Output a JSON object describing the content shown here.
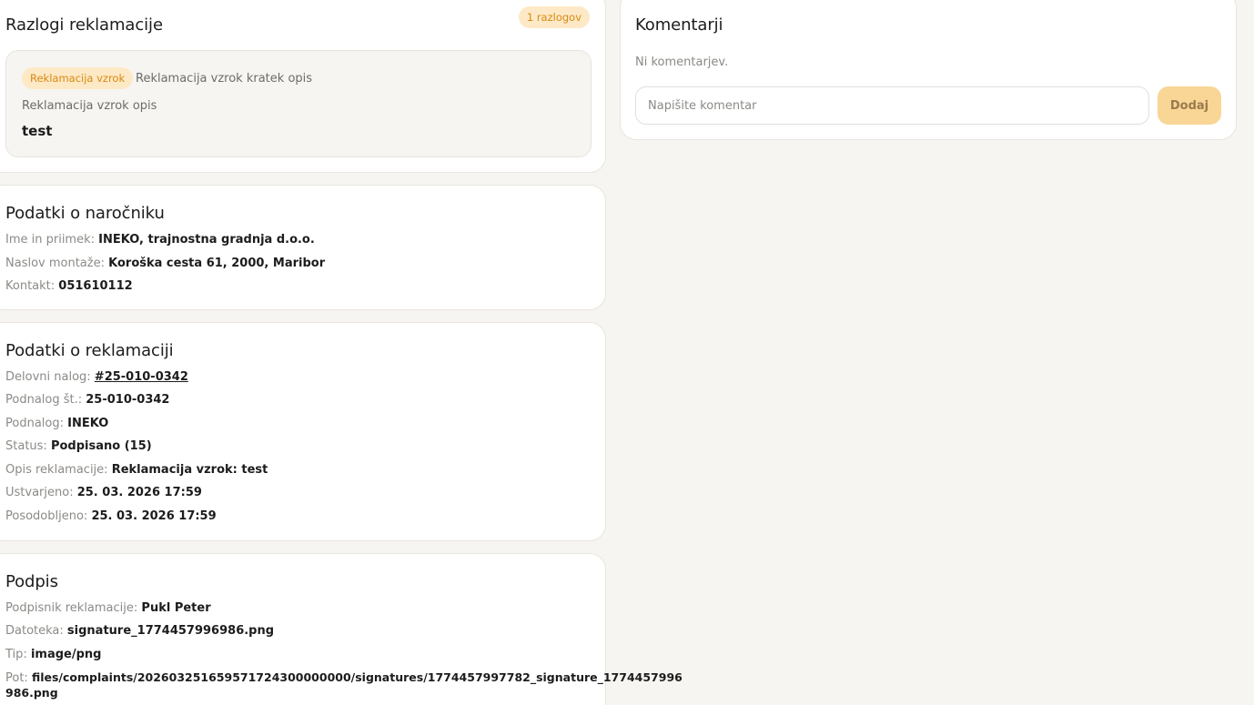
{
  "reasons": {
    "title": "Razlogi reklamacije",
    "count_badge": "1 razlogov",
    "items": [
      {
        "tag": "Reklamacija vzrok",
        "short_description": "Reklamacija vzrok kratek opis",
        "description_label": "Reklamacija vzrok opis",
        "description": "test"
      }
    ]
  },
  "customer": {
    "title": "Podatki o naročniku",
    "name_label": "Ime in priimek:",
    "name": "INEKO, trajnostna gradnja d.o.o.",
    "address_label": "Naslov montaže:",
    "address": "Koroška cesta 61, 2000, Maribor",
    "contact_label": "Kontakt:",
    "contact": "051610112"
  },
  "complaint": {
    "title": "Podatki o reklamaciji",
    "work_order_label": "Delovni nalog:",
    "work_order": "#25-010-0342",
    "suborder_no_label": "Podnalog št.:",
    "suborder_no": "25-010-0342",
    "suborder_label": "Podnalog:",
    "suborder": "INEKO",
    "status_label": "Status:",
    "status": "Podpisano (15)",
    "description_label": "Opis reklamacije:",
    "description": "Reklamacija vzrok: test",
    "created_label": "Ustvarjeno:",
    "created": "25. 03. 2026 17:59",
    "updated_label": "Posodobljeno:",
    "updated": "25. 03. 2026 17:59"
  },
  "signature": {
    "title": "Podpis",
    "signer_label": "Podpisnik reklamacije:",
    "signer": "Pukl Peter",
    "file_label": "Datoteka:",
    "file": "signature_1774457996986.png",
    "type_label": "Tip:",
    "type": "image/png",
    "path_label": "Pot:",
    "path_line1": "files/complaints/202603251659571724300000000/signatures/1774457997782_signature_1774457996",
    "path_line2": "986.png"
  },
  "comments": {
    "title": "Komentarji",
    "empty_text": "Ni komentarjev.",
    "input_placeholder": "Napišite komentar",
    "add_label": "Dodaj"
  },
  "colors": {
    "accent_bg": "#fde9c6",
    "accent_text": "#d88a12",
    "button_bg": "#f9d696",
    "page_bg": "#f7f5f1"
  }
}
